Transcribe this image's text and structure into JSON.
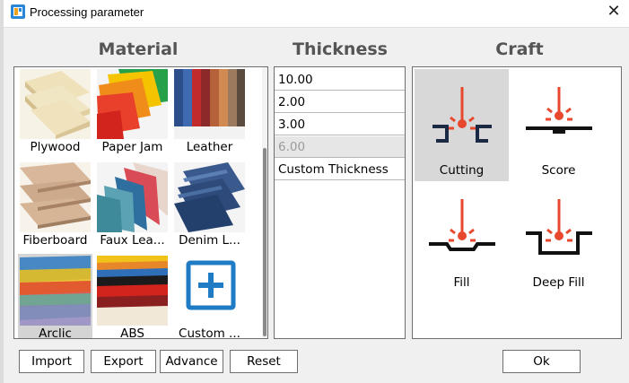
{
  "window": {
    "title": "Processing parameter"
  },
  "headings": {
    "material": "Material",
    "thickness": "Thickness",
    "craft": "Craft"
  },
  "materials": [
    {
      "label": "Plywood",
      "selected": false
    },
    {
      "label": "Paper Jam",
      "selected": false
    },
    {
      "label": "Leather",
      "selected": false
    },
    {
      "label": "Fiberboard",
      "selected": false
    },
    {
      "label": "Faux Lea...",
      "selected": false
    },
    {
      "label": "Denim L...",
      "selected": false
    },
    {
      "label": "Arclic",
      "selected": true
    },
    {
      "label": "ABS",
      "selected": false
    },
    {
      "label": "Custom ...",
      "selected": false
    }
  ],
  "thickness": [
    {
      "label": "10.00",
      "disabled": false
    },
    {
      "label": "2.00",
      "disabled": false
    },
    {
      "label": "3.00",
      "disabled": false
    },
    {
      "label": "6.00",
      "disabled": true
    },
    {
      "label": "Custom Thickness",
      "disabled": false
    }
  ],
  "craft": [
    {
      "label": "Cutting",
      "selected": true
    },
    {
      "label": "Score",
      "selected": false
    },
    {
      "label": "Fill",
      "selected": false
    },
    {
      "label": "Deep Fill",
      "selected": false
    }
  ],
  "buttons": {
    "import": "Import",
    "export": "Export",
    "advance": "Advance",
    "reset": "Reset",
    "ok": "Ok"
  },
  "colors": {
    "laser": "#e8492e",
    "selected_bg": "#d4d4d4",
    "accent_blue": "#1e7bc4"
  }
}
